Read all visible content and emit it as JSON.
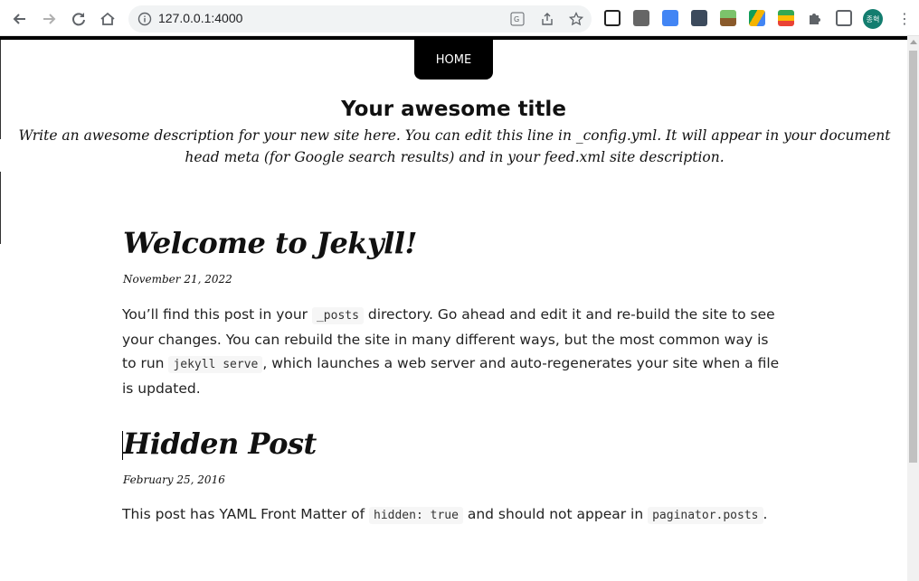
{
  "browser": {
    "url": "127.0.0.1:4000",
    "avatar_text": "종혁",
    "icons": [
      "back-icon",
      "forward-icon",
      "reload-icon",
      "home-icon",
      "info-icon",
      "translate-icon",
      "share-icon",
      "star-icon",
      "notion-icon",
      "extension-square-icon",
      "google-translate-icon",
      "calculator-icon",
      "plant-icon",
      "google-drive-icon",
      "google-keep-icon",
      "puzzle-icon",
      "side-panel-icon",
      "kebab-menu-icon"
    ]
  },
  "site": {
    "nav_home": "HOME",
    "title": "Your awesome title",
    "description": "Write an awesome description for your new site here. You can edit this line in _config.yml. It will appear in your document head meta (for Google search results) and in your feed.xml site description."
  },
  "posts": [
    {
      "title": "Welcome to Jekyll!",
      "date": "November 21, 2022",
      "body_1": "You’ll find this post in your ",
      "code_1": "_posts",
      "body_2": " directory. Go ahead and edit it and re-build the site to see your changes. You can rebuild the site in many different ways, but the most common way is to run ",
      "code_2": "jekyll serve",
      "body_3": ", which launches a web server and auto-regenerates your site when a file is updated."
    },
    {
      "title": "Hidden Post",
      "date": "February 25, 2016",
      "body_1": "This post has YAML Front Matter of ",
      "code_1": "hidden: true",
      "body_2": " and should not appear in ",
      "code_2": "paginator.posts",
      "body_3": "."
    }
  ],
  "colors": {
    "accent": "#000000",
    "avatar": "#137d6f",
    "code_bg": "#f6f6f6"
  }
}
